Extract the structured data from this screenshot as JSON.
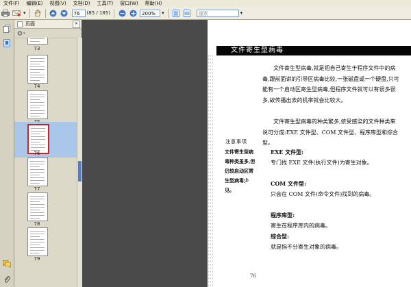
{
  "menu": {
    "items": [
      "文件(F)",
      "编辑(E)",
      "视图(V)",
      "文档(D)",
      "工具(T)",
      "窗口(W)",
      "帮助(H)"
    ]
  },
  "toolbar": {
    "page_value": "76",
    "page_total": "(85 / 185)",
    "zoom_value": "200%",
    "search_placeholder": "搜索"
  },
  "panel": {
    "title": "页面"
  },
  "thumbnails": [
    {
      "label": "73"
    },
    {
      "label": "74"
    },
    {
      "label": "75"
    },
    {
      "label": "76",
      "selected": true
    },
    {
      "label": "77"
    },
    {
      "label": "78"
    },
    {
      "label": "79"
    }
  ],
  "document": {
    "section_title": "文件寄生型病毒",
    "paragraphs": [
      "　　文件寄生型病毒,就是把自己寄生于程序文件中的病毒,跟前面讲的引导区病毒比较,一张磁盘或一个硬盘,只可能有一个启动区寄生型病毒,但程序文件就可以有很多很多,故传播出去的机率就会比较大。",
      "　　文件寄生型病毒的种类繁多,依受感染的文件种类来说可分成:EXE 文件型、COM 文件型、程序库型和综合型。"
    ],
    "items": [
      {
        "heading": "EXE 文件型:",
        "text": "专门找 EXE 文件(执行文件)为寄生对象。"
      },
      {
        "heading": "COM 文件型:",
        "text": "只会在 COM 文件(命令文件)找到的病毒。"
      },
      {
        "heading": "程序库型:",
        "text": "寄生在程序库内的病毒。"
      },
      {
        "heading": "综合型:",
        "text": "就是指不分寄生对象的病毒。"
      }
    ],
    "sidebar": {
      "heading": "注意事项",
      "text": "文件寄生型病毒种类虽多,但仍较启动区寄生型病毒少见。"
    },
    "page_number": "76"
  },
  "colors": {
    "selection": "#aac6e8",
    "thumb_border_selected": "#c0262a",
    "scroll_thumb": "#5a7db8"
  }
}
